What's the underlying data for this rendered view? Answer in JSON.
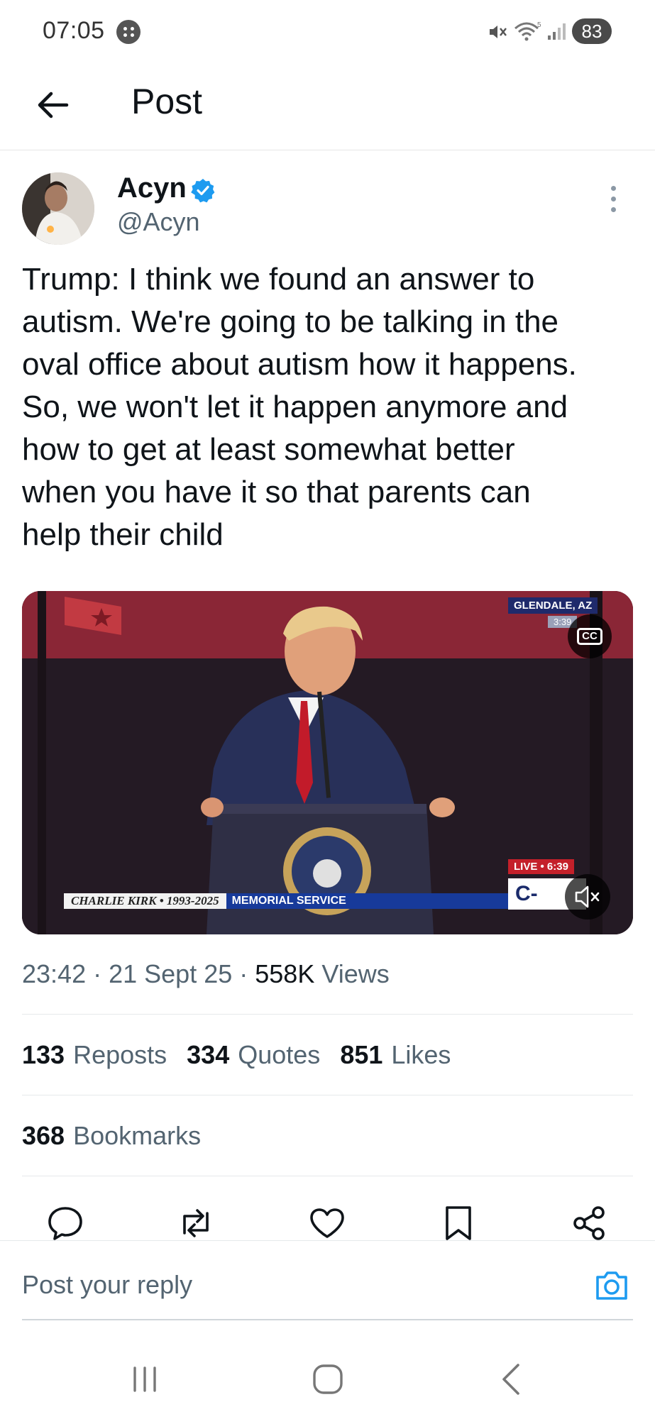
{
  "status_bar": {
    "time": "07:05",
    "battery": "83"
  },
  "header": {
    "title": "Post"
  },
  "author": {
    "name": "Acyn",
    "handle": "@Acyn",
    "verified": true
  },
  "post": {
    "text": "Trump: I think we found an answer to\nautism. We're going to be talking in the\noval office about autism how it happens.\nSo, we won't let it happen anymore and\nhow to get at least somewhat better\nwhen you have it so that parents can\nhelp their child"
  },
  "media": {
    "location": "GLENDALE, AZ",
    "location_time": "3:39",
    "lower_third_name": "CHARLIE KIRK  •  1993-2025",
    "lower_third_event": "MEMORIAL SERVICE",
    "live_label": "LIVE  •  6:39",
    "network": "C-SPAN",
    "cc_label": "CC"
  },
  "meta": {
    "time": "23:42",
    "separator": " · ",
    "date": "21 Sept 25",
    "views_count": "558K",
    "views_label": "Views"
  },
  "stats": {
    "reposts_count": "133",
    "reposts_label": "Reposts",
    "quotes_count": "334",
    "quotes_label": "Quotes",
    "likes_count": "851",
    "likes_label": "Likes",
    "bookmarks_count": "368",
    "bookmarks_label": "Bookmarks"
  },
  "actions": [
    "reply-icon",
    "repost-icon",
    "like-icon",
    "bookmark-icon",
    "share-icon"
  ],
  "reply": {
    "placeholder": "Post your reply"
  },
  "colors": {
    "accent": "#1d9bf0",
    "text_primary": "#0f1419",
    "text_secondary": "#536471"
  }
}
